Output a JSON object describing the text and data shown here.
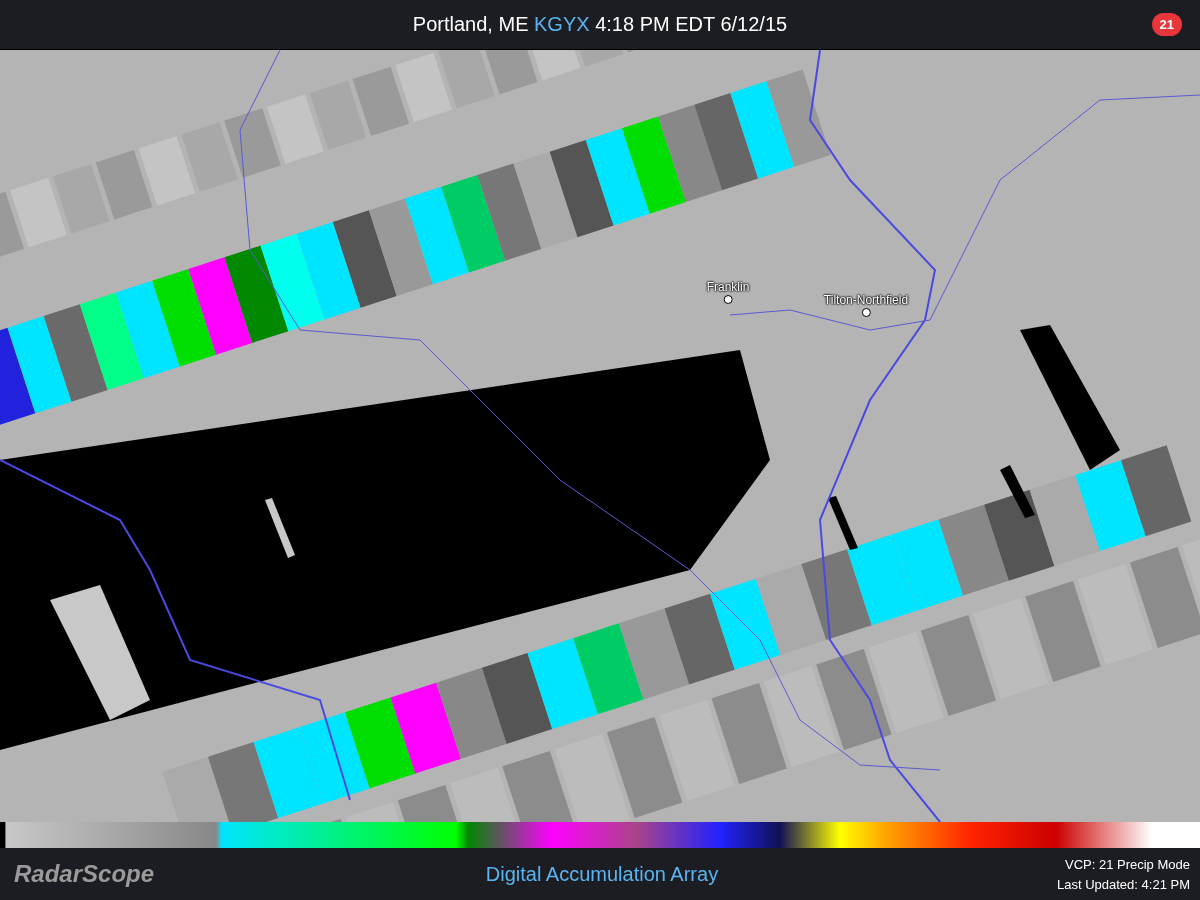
{
  "header": {
    "location": "Portland, ME",
    "station": "KGYX",
    "time": "4:18 PM EDT 6/12/15",
    "badge": "21"
  },
  "map": {
    "cities": [
      {
        "name": "Franklin"
      },
      {
        "name": "Tilton-Northfield"
      }
    ]
  },
  "footer": {
    "logo": "RadarScope",
    "product": "Digital Accumulation Array",
    "vcp": "VCP: 21 Precip Mode",
    "updated": "Last Updated: 4:21 PM"
  }
}
